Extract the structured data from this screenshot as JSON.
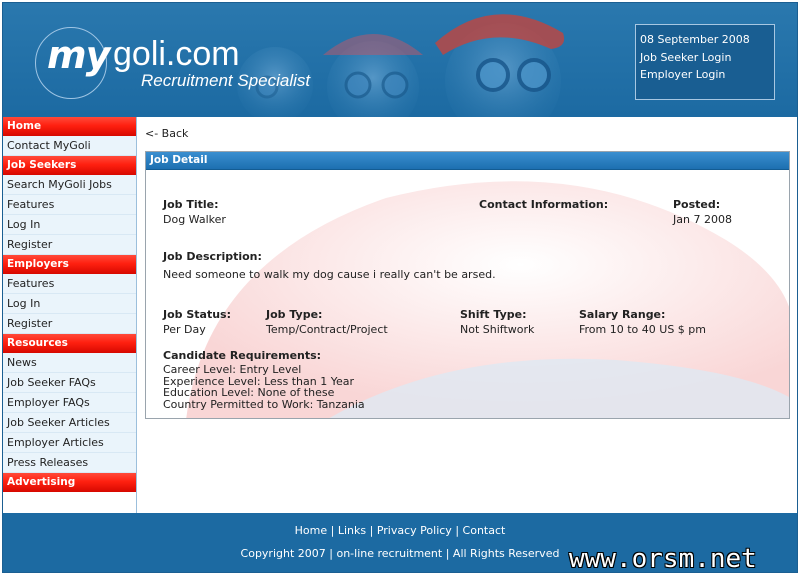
{
  "header": {
    "logo_my": "my",
    "logo_domain": "goli.com",
    "tagline": "Recruitment Specialist",
    "date": "08 September 2008",
    "job_seeker_login": "Job Seeker Login",
    "employer_login": "Employer Login"
  },
  "sidebar": {
    "home": "Home",
    "contact": "Contact MyGoli",
    "job_seekers": {
      "title": "Job Seekers",
      "items": [
        "Search MyGoli Jobs",
        "Features",
        "Log In",
        "Register"
      ]
    },
    "employers": {
      "title": "Employers",
      "items": [
        "Features",
        "Log In",
        "Register"
      ]
    },
    "resources": {
      "title": "Resources",
      "items": [
        "News",
        "Job Seeker FAQs",
        "Employer FAQs",
        "Job Seeker Articles",
        "Employer Articles",
        "Press Releases"
      ]
    },
    "advertising": "Advertising"
  },
  "main": {
    "back": "<- Back",
    "panel_title": "Job Detail",
    "job_title_label": "Job Title:",
    "job_title": "Dog Walker",
    "contact_label": "Contact Information:",
    "posted_label": "Posted:",
    "posted": "Jan 7 2008",
    "description_label": "Job Description:",
    "description": "Need someone to walk my dog cause i really can't be arsed.",
    "status_label": "Job Status:",
    "status": "Per Day",
    "type_label": "Job Type:",
    "type": "Temp/Contract/Project",
    "shift_label": "Shift Type:",
    "shift": "Not Shiftwork",
    "salary_label": "Salary Range:",
    "salary": "From 10 to 40 US $ pm",
    "requirements_label": "Candidate Requirements:",
    "requirements": [
      "Career Level: Entry Level",
      "Experience Level: Less than 1 Year",
      "Education Level: None of these",
      "Country Permitted to Work: Tanzania"
    ]
  },
  "footer": {
    "links": [
      "Home",
      "Links",
      "Privacy Policy",
      "Contact"
    ],
    "separator": "|",
    "copyright": "Copyright 2007 | on-line recruitment | All Rights Reserved",
    "watermark": "www.orsm.net"
  }
}
